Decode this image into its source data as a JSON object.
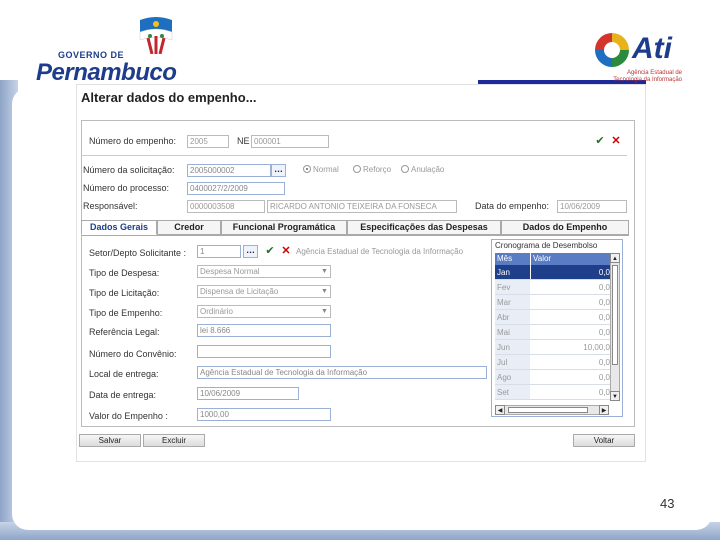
{
  "slide": {
    "page_number": "43"
  },
  "logos": {
    "left_small": "GOVERNO DE",
    "left_big": "Pernambuco",
    "right_big": "Ati",
    "right_sub": "Agência Estadual de Tecnologia da Informação"
  },
  "form": {
    "title": "Alterar dados do empenho...",
    "empenho": {
      "label": "Número do empenho:",
      "year": "2005",
      "ne_label": "NE",
      "number": "000001"
    },
    "solicitacao": {
      "label": "Número da solicitação:",
      "value": "2005000002",
      "radios": [
        "Normal",
        "Reforço",
        "Anulação"
      ],
      "selected_radio": "Normal"
    },
    "processo": {
      "label": "Número do processo:",
      "value": "0400027/2/2009"
    },
    "responsavel": {
      "label": "Responsável:",
      "code": "0000003508",
      "name": "RICARDO ANTONIO TEIXEIRA DA FONSECA",
      "date_label": "Data do empenho:",
      "date": "10/06/2009"
    },
    "tabs": [
      {
        "label": "Dados Gerais",
        "active": true
      },
      {
        "label": "Credor",
        "active": false
      },
      {
        "label": "Funcional Programática",
        "active": false
      },
      {
        "label": "Especificações das Despesas",
        "active": false
      },
      {
        "label": "Dados do Empenho",
        "active": false
      }
    ],
    "dados_gerais": {
      "setor_label": "Setor/Depto Solicitante :",
      "setor_code": "1",
      "setor_name": "Agência Estadual de Tecnologia da Informação",
      "tipo_despesa_label": "Tipo de Despesa:",
      "tipo_despesa": "Despesa Normal",
      "tipo_licitacao_label": "Tipo de Licitação:",
      "tipo_licitacao": "Dispensa de Licitação",
      "tipo_empenho_label": "Tipo de Empenho:",
      "tipo_empenho": "Ordinário",
      "referencia_label": "Referência Legal:",
      "referencia": "lei 8.666",
      "convenio_label": "Número do Convênio:",
      "convenio": "",
      "local_label": "Local de entrega:",
      "local": "Agência Estadual de Tecnologia da Informação",
      "data_entrega_label": "Data de entrega:",
      "data_entrega": "10/06/2009",
      "valor_label": "Valor do Empenho :",
      "valor": "1000,00"
    },
    "cronograma": {
      "title": "Cronograma de Desembolso",
      "col_mes": "Mês",
      "col_valor": "Valor",
      "rows": [
        {
          "mes": "Jan",
          "valor": "0,0"
        },
        {
          "mes": "Fev",
          "valor": "0,0"
        },
        {
          "mes": "Mar",
          "valor": "0,0"
        },
        {
          "mes": "Abr",
          "valor": "0,0"
        },
        {
          "mes": "Mai",
          "valor": "0,0"
        },
        {
          "mes": "Jun",
          "valor": "10,00,0"
        },
        {
          "mes": "Jul",
          "valor": "0,0"
        },
        {
          "mes": "Ago",
          "valor": "0,0"
        },
        {
          "mes": "Set",
          "valor": "0,0"
        }
      ],
      "selected_row": 0
    },
    "buttons": {
      "salvar": "Salvar",
      "excluir": "Excluir",
      "voltar": "Voltar"
    }
  },
  "colors": {
    "accent": "#1e3c8c",
    "selected_row": "#1f3f8a",
    "slide_bar": "#8ea5c8"
  }
}
